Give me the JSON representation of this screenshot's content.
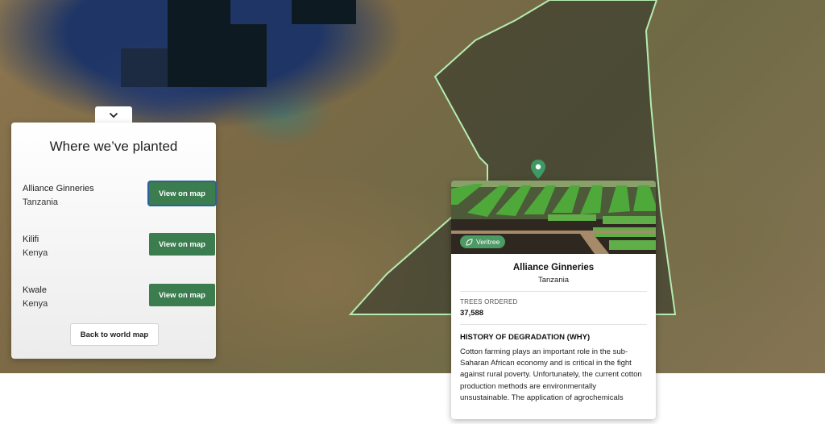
{
  "map": {
    "marker_icon": "map-pin-icon",
    "region_outline_color": "#b5ecb0"
  },
  "panel": {
    "toggle_icon": "chevron-down-icon",
    "title": "Where we’ve planted",
    "sites": [
      {
        "name": "Alliance Ginneries",
        "country": "Tanzania",
        "button": "View on map"
      },
      {
        "name": "Kilifi",
        "country": "Kenya",
        "button": "View on map"
      },
      {
        "name": "Kwale",
        "country": "Kenya",
        "button": "View on map"
      }
    ],
    "back_button": "Back to world map"
  },
  "card": {
    "badge": "Veritree",
    "name": "Alliance Ginneries",
    "country": "Tanzania",
    "trees_label": "TREES ORDERED",
    "trees_value": "37,588",
    "history_heading": "HISTORY OF DEGRADATION (WHY)",
    "history_text": "Cotton farming plays an important role in the sub-Saharan African economy and is critical in the fight against rural poverty. Unfortunately, the current cotton production methods are environmentally unsustainable. The application of agrochemicals"
  },
  "colors": {
    "button_green": "#3b7d4f",
    "badge_green": "#4c9a64",
    "marker_green": "#3e9a63"
  }
}
